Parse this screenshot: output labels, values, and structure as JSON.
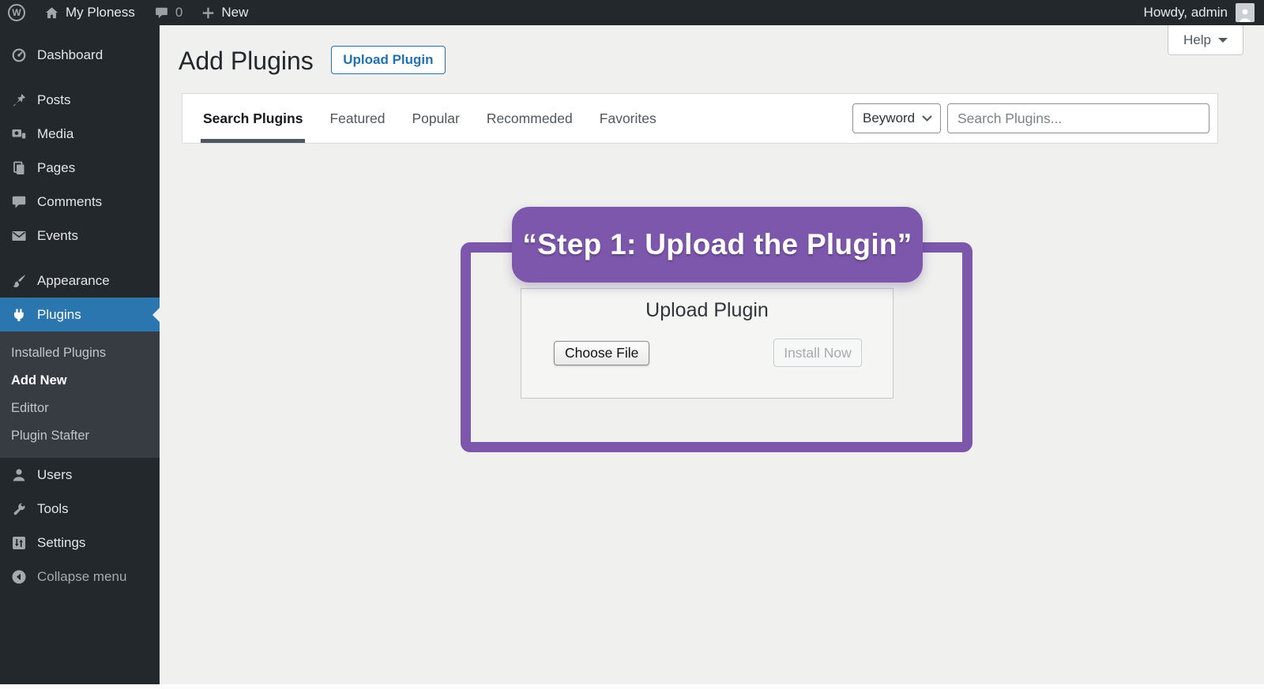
{
  "colors": {
    "accent_purple": "#7d57ab",
    "wp_blue": "#2b76ae"
  },
  "admin_bar": {
    "wp_logo_letter": "W",
    "site_name": "My Ploness",
    "comments_count": "0",
    "new_label": "New",
    "howdy": "Howdy, admin"
  },
  "help": {
    "label": "Help"
  },
  "page": {
    "title": "Add Plugins",
    "upload_button": "Upload Plugin"
  },
  "tabs": [
    "Search Plugins",
    "Featured",
    "Popular",
    "Recommeded",
    "Favorites"
  ],
  "filter": {
    "selected": "Beyword"
  },
  "search": {
    "placeholder": "Search Plugins..."
  },
  "callout": {
    "text": "“Step 1: Upload the Plugin”"
  },
  "upload_box": {
    "title": "Upload Plugin",
    "choose_file_label": "Choose File",
    "install_now_label": "Install Now"
  },
  "sidebar": {
    "items": [
      "Dashboard",
      "Posts",
      "Media",
      "Pages",
      "Comments",
      "Events",
      "Appearance",
      "Plugins",
      "Users",
      "Tools",
      "Settings",
      "Collapse menu"
    ],
    "plugins_submenu": [
      "Installed Plugins",
      "Add New",
      "Edittor",
      "Plugin Stafter"
    ]
  }
}
